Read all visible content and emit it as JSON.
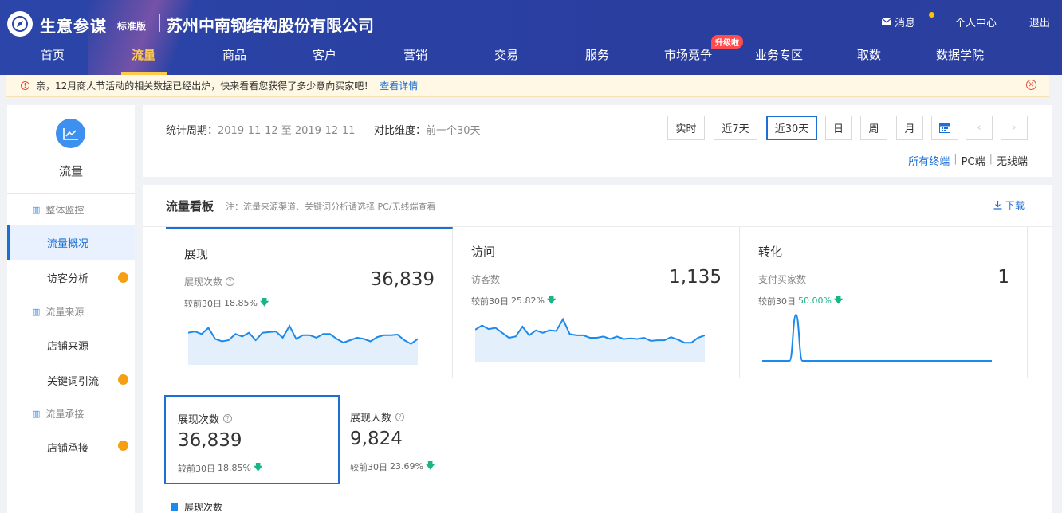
{
  "header": {
    "brand": "生意参谋",
    "edition": "标准版",
    "company": "苏州中南钢结构股份有限公司",
    "messages_label": "消息",
    "user_center": "个人中心",
    "logout": "退出",
    "nav": [
      "首页",
      "流量",
      "商品",
      "客户",
      "营销",
      "交易",
      "服务",
      "市场竞争",
      "业务专区",
      "取数",
      "数据学院"
    ],
    "active_nav": "流量",
    "upgrade_badge": "升级啦"
  },
  "notice": {
    "text": "亲，12月商人节活动的相关数据已经出炉，快来看看您获得了多少意向买家吧！",
    "link": "查看详情"
  },
  "sidebar": {
    "title": "流量",
    "groups": [
      {
        "label": "整体监控",
        "items": [
          {
            "label": "流量概况",
            "active": true,
            "dot": false
          },
          {
            "label": "访客分析",
            "active": false,
            "dot": true
          }
        ]
      },
      {
        "label": "流量来源",
        "items": [
          {
            "label": "店铺来源",
            "active": false,
            "dot": false
          },
          {
            "label": "关键词引流",
            "active": false,
            "dot": true
          }
        ]
      },
      {
        "label": "流量承接",
        "items": [
          {
            "label": "店铺承接",
            "active": false,
            "dot": true
          }
        ]
      }
    ]
  },
  "filter": {
    "period_label": "统计周期：",
    "period_value": "2019-11-12 至 2019-12-11",
    "compare_label": "对比维度：",
    "compare_value": "前一个30天",
    "buttons": [
      "实时",
      "近7天",
      "近30天",
      "日",
      "周",
      "月"
    ],
    "active_button": "近30天",
    "terminals": [
      "所有终端",
      "PC端",
      "无线端"
    ],
    "active_terminal": "所有终端"
  },
  "board": {
    "title": "流量看板",
    "note": "注：流量来源渠道、关键词分析请选择 PC/无线端查看",
    "download": "下载",
    "metrics": [
      {
        "name": "展现",
        "label": "展现次数",
        "value": "36,839",
        "compare_prefix": "较前30日",
        "compare_value": "18.85%",
        "highlight": false,
        "active": true,
        "series": [
          52,
          54,
          50,
          60,
          42,
          38,
          40,
          50,
          46,
          52,
          40,
          52,
          53,
          54,
          44,
          63,
          42,
          48,
          48,
          44,
          50,
          50,
          42,
          36,
          40,
          44,
          42,
          38,
          45,
          48,
          48,
          49,
          40,
          34,
          42
        ]
      },
      {
        "name": "访问",
        "label": "访客数",
        "value": "1,135",
        "compare_prefix": "较前30日",
        "compare_value": "25.82%",
        "highlight": false,
        "active": false,
        "series": [
          53,
          60,
          54,
          56,
          48,
          40,
          42,
          58,
          44,
          52,
          48,
          52,
          51,
          70,
          46,
          44,
          44,
          40,
          40,
          42,
          38,
          42,
          38,
          39,
          38,
          40,
          35,
          36,
          36,
          41,
          37,
          32,
          32,
          40,
          44
        ]
      },
      {
        "name": "转化",
        "label": "支付买家数",
        "value": "1",
        "compare_prefix": "较前30日",
        "compare_value": "50.00%",
        "highlight": true,
        "active": false,
        "series": [
          0,
          0,
          0,
          0,
          0,
          1,
          0,
          0,
          0,
          0,
          0,
          0,
          0,
          0,
          0,
          0,
          0,
          0,
          0,
          0,
          0,
          0,
          0,
          0,
          0,
          0,
          0,
          0,
          0,
          0,
          0,
          0,
          0,
          0,
          0
        ]
      }
    ],
    "sub_metrics": [
      {
        "label": "展现次数",
        "value": "36,839",
        "compare_prefix": "较前30日",
        "compare_value": "18.85%",
        "active": true
      },
      {
        "label": "展现人数",
        "value": "9,824",
        "compare_prefix": "较前30日",
        "compare_value": "23.69%",
        "active": false
      }
    ],
    "legend": "展现次数"
  },
  "colors": {
    "accent": "#1c6fd6",
    "header_bg": "#2b45a8",
    "up_down_green": "#1ab587",
    "dot_orange": "#f6a011"
  }
}
